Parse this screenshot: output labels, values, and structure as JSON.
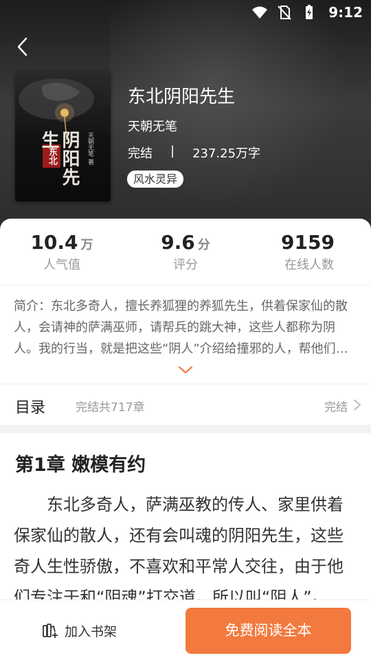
{
  "status_bar": {
    "time": "9:12",
    "icons": [
      "wifi-icon",
      "no-sim-icon",
      "battery-charging-icon"
    ]
  },
  "book": {
    "title": "东北阴阳先生",
    "author": "天朝无笔",
    "status": "完结",
    "separator": "|",
    "word_count": "237.25万字",
    "tag": "风水灵异",
    "cover": {
      "title": "阴阳先生",
      "prefix": "东北",
      "author": "天朝无笔 著"
    }
  },
  "stats": [
    {
      "value": "10.4",
      "unit": "万",
      "label": "人气值"
    },
    {
      "value": "9.6",
      "unit": "分",
      "label": "评分"
    },
    {
      "value": "9159",
      "unit": "",
      "label": "在线人数"
    }
  ],
  "intro": "简介：东北多奇人，擅长养狐狸的养狐先生，供着保家仙的散人，会请神的萨满巫师，请帮兵的跳大神，这些人都称为阴人。我的行当，就是把这些“阴人”介绍给撞邪的人，帮他们消灾解难。",
  "toc": {
    "label": "目录",
    "chapter_count": "完结共717章",
    "status": "完结"
  },
  "chapter": {
    "title": "第1章 嫩模有约",
    "body": "东北多奇人，萨满巫教的传人、家里供着保家仙的散人，还有会叫魂的阴阳先生，这些奇人生性骄傲，不喜欢和平常人交往，由于他们专注于和“阴魂”打交道，所以叫“阴人”。"
  },
  "actions": {
    "add_shelf": "加入书架",
    "read_free": "免费阅读全本"
  },
  "colors": {
    "accent": "#f37a3e",
    "cover_badge": "#9a1c1c"
  }
}
